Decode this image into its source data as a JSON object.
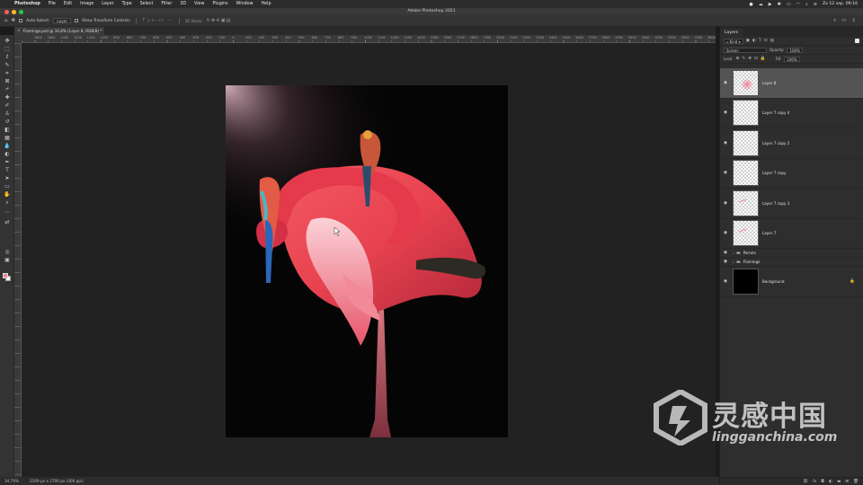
{
  "menubar": {
    "app": "Photoshop",
    "items": [
      "File",
      "Edit",
      "Image",
      "Layer",
      "Type",
      "Select",
      "Filter",
      "3D",
      "View",
      "Plugins",
      "Window",
      "Help"
    ],
    "clock": "Zo 12 sep.  09:16"
  },
  "window": {
    "title": "Adobe Photoshop 2021"
  },
  "options": {
    "auto_select_label": "Auto-Select:",
    "auto_select_value": "Layer",
    "transform_label": "Show Transform Controls",
    "mode_label": "3D Mode:"
  },
  "document": {
    "tab_title": "Flamingo.psd @ 34,8% (Layer 8, RGB/8) *"
  },
  "ruler": {
    "numbers": [
      "1800",
      "1600",
      "1400",
      "1200",
      "1100",
      "1000",
      "900",
      "800",
      "700",
      "600",
      "500",
      "400",
      "300",
      "200",
      "100",
      "0",
      "100",
      "200",
      "300",
      "400",
      "500",
      "600",
      "700",
      "800",
      "900",
      "1000",
      "1100",
      "1200",
      "1300",
      "1400",
      "1500",
      "1600",
      "1700",
      "1800",
      "1900",
      "2000",
      "2100",
      "2200",
      "2300",
      "2400",
      "2500",
      "2600",
      "2700",
      "2800",
      "2900",
      "3000",
      "3100",
      "3200",
      "3300",
      "3400",
      "3500",
      "3600",
      "3700",
      "3800",
      "3900"
    ]
  },
  "status": {
    "zoom": "34,76%",
    "size": "2169 px x 2700 px (300 ppi)"
  },
  "layers_panel": {
    "tab": "Layers",
    "filter_kind": "Kind",
    "blend_mode": "Screen",
    "opacity_label": "Opacity:",
    "opacity_value": "100%",
    "lock_label": "Lock:",
    "fill_label": "Fill:",
    "fill_value": "100%",
    "layers": [
      {
        "name": "Layer 8",
        "thumb": "glow",
        "selected": true
      },
      {
        "name": "Layer 7 copy 4",
        "thumb": "empty"
      },
      {
        "name": "Layer 7 copy 2",
        "thumb": "empty"
      },
      {
        "name": "Layer 7 copy",
        "thumb": "empty"
      },
      {
        "name": "Layer 7 copy 3",
        "thumb": "stroke"
      },
      {
        "name": "Layer 7",
        "thumb": "stroke"
      },
      {
        "name": "Parrots",
        "group": true
      },
      {
        "name": "Flamingo",
        "group": true
      },
      {
        "name": "Background",
        "thumb": "dark",
        "locked": true
      }
    ]
  },
  "watermark": {
    "cn": "灵感中国",
    "en": "lingganchina.com"
  },
  "colors": {
    "foreground": "#e88a96",
    "background": "#ffffff",
    "accent": "#1473e6"
  }
}
